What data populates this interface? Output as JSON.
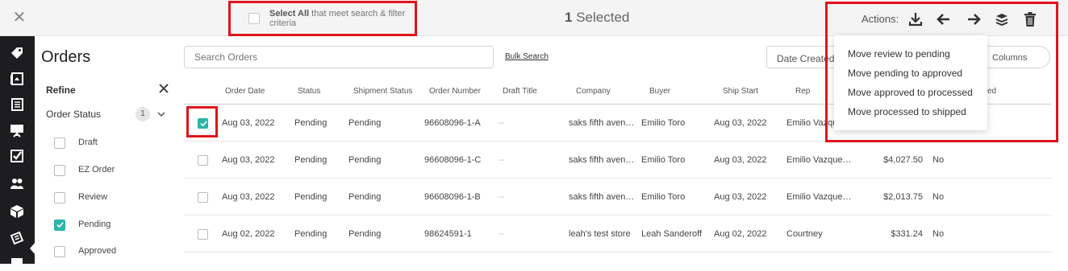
{
  "topbar": {
    "select_all_bold": "Select All",
    "select_all_rest": " that meet search & filter criteria",
    "selected_number": "1",
    "selected_word": " Selected",
    "actions_label": "Actions:",
    "action_icons": [
      "download-icon",
      "arrow-left-icon",
      "arrow-right-icon",
      "move-stack-icon",
      "trash-icon"
    ]
  },
  "actions_menu": [
    "Move review to pending",
    "Move pending to approved",
    "Move approved to processed",
    "Move processed to shipped"
  ],
  "rail": {
    "icons": [
      "tag-icon",
      "catalog-icon",
      "book-icon",
      "presentation-icon",
      "checklist-icon",
      "users-icon",
      "box-icon",
      "ticket-icon"
    ],
    "active_index": 6
  },
  "page": {
    "title": "Orders",
    "refine_label": "Refine",
    "order_status_label": "Order Status",
    "order_status_count": "1",
    "filters": [
      {
        "label": "Draft",
        "checked": false
      },
      {
        "label": "EZ Order",
        "checked": false
      },
      {
        "label": "Review",
        "checked": false
      },
      {
        "label": "Pending",
        "checked": true
      },
      {
        "label": "Approved",
        "checked": false
      }
    ]
  },
  "search": {
    "placeholder": "Search Orders",
    "bulk_label": "Bulk Search",
    "date_filter": "Date Created",
    "columns_label": "Columns"
  },
  "table": {
    "headers": [
      "Order Date",
      "Status",
      "Shipment Status",
      "Order Number",
      "Draft Title",
      "Company",
      "Buyer",
      "Ship Start",
      "Rep",
      "ed"
    ],
    "rows": [
      {
        "checked": true,
        "date": "Aug 03, 2022",
        "status": "Pending",
        "shipment": "Pending",
        "number": "96608096-1-A",
        "draft": "--",
        "company": "saks fifth aven…",
        "buyer": "Emilio Toro",
        "ship_start": "Aug 03, 2022",
        "rep": "Emilio Vazqu",
        "amount": "",
        "flag": ""
      },
      {
        "checked": false,
        "date": "Aug 03, 2022",
        "status": "Pending",
        "shipment": "Pending",
        "number": "96608096-1-C",
        "draft": "--",
        "company": "saks fifth aven…",
        "buyer": "Emilio Toro",
        "ship_start": "Aug 03, 2022",
        "rep": "Emilio Vazque…",
        "amount": "$4,027.50",
        "flag": "No"
      },
      {
        "checked": false,
        "date": "Aug 03, 2022",
        "status": "Pending",
        "shipment": "Pending",
        "number": "96608096-1-B",
        "draft": "--",
        "company": "saks fifth aven…",
        "buyer": "Emilio Toro",
        "ship_start": "Aug 03, 2022",
        "rep": "Emilio Vazque…",
        "amount": "$2,013.75",
        "flag": "No"
      },
      {
        "checked": false,
        "date": "Aug 02, 2022",
        "status": "Pending",
        "shipment": "Pending",
        "number": "98624591-1",
        "draft": "--",
        "company": "leah's test store",
        "buyer": "Leah Sanderoff",
        "ship_start": "Aug 02, 2022",
        "rep": "Courtney",
        "amount": "$331.24",
        "flag": "No"
      }
    ]
  }
}
